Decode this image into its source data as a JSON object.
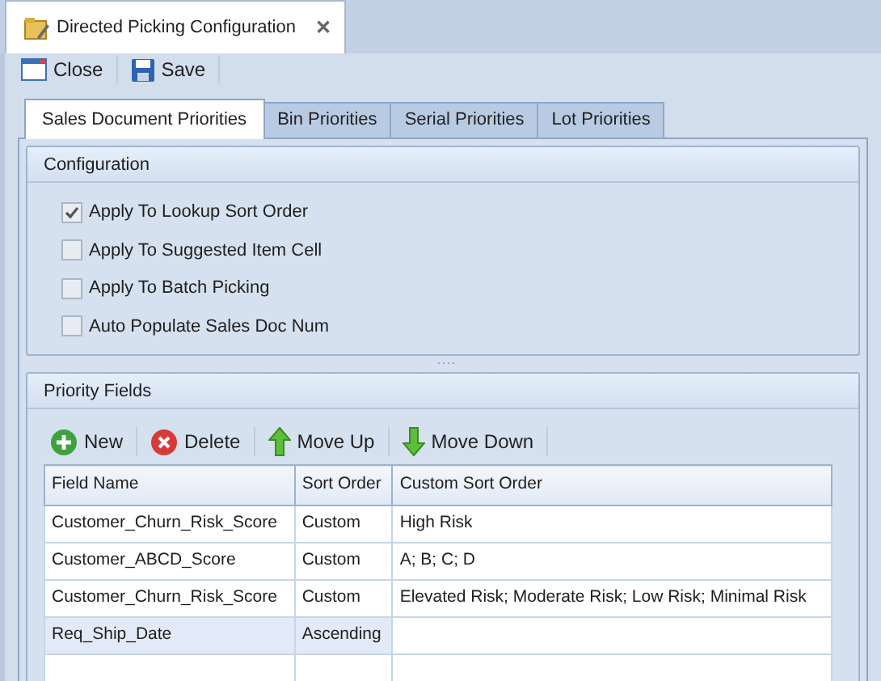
{
  "document_tab": {
    "title": "Directed Picking Configuration",
    "close": "✕"
  },
  "toolbar": [
    {
      "label": "Close"
    },
    {
      "label": "Save"
    }
  ],
  "tabs": [
    {
      "label": "Sales Document Priorities",
      "selected": true
    },
    {
      "label": "Bin Priorities",
      "selected": false
    },
    {
      "label": "Serial Priorities",
      "selected": false
    },
    {
      "label": "Lot Priorities",
      "selected": false
    }
  ],
  "configuration": {
    "title": "Configuration",
    "options": [
      {
        "label": "Apply To Lookup Sort Order",
        "checked": true
      },
      {
        "label": "Apply To Suggested Item Cell",
        "checked": false
      },
      {
        "label": "Apply To Batch Picking",
        "checked": false
      },
      {
        "label": "Auto Populate Sales Doc Num",
        "checked": false
      }
    ]
  },
  "splitter": "····",
  "priority_fields": {
    "title": "Priority Fields",
    "actions": [
      {
        "label": "New"
      },
      {
        "label": "Delete"
      },
      {
        "label": "Move Up"
      },
      {
        "label": "Move Down"
      }
    ],
    "table": {
      "columns": [
        "Field Name",
        "Sort Order",
        "Custom Sort Order"
      ],
      "rows": [
        {
          "cells": [
            "Customer_Churn_Risk_Score",
            "Custom",
            "High Risk"
          ],
          "selected": false
        },
        {
          "cells": [
            "Customer_ABCD_Score",
            "Custom",
            "A; B; C; D"
          ],
          "selected": false
        },
        {
          "cells": [
            "Customer_Churn_Risk_Score",
            "Custom",
            "Elevated Risk; Moderate Risk; Low Risk; Minimal Risk"
          ],
          "selected": false
        },
        {
          "cells": [
            "Req_Ship_Date",
            "Ascending",
            ""
          ],
          "selected": true
        }
      ]
    }
  }
}
